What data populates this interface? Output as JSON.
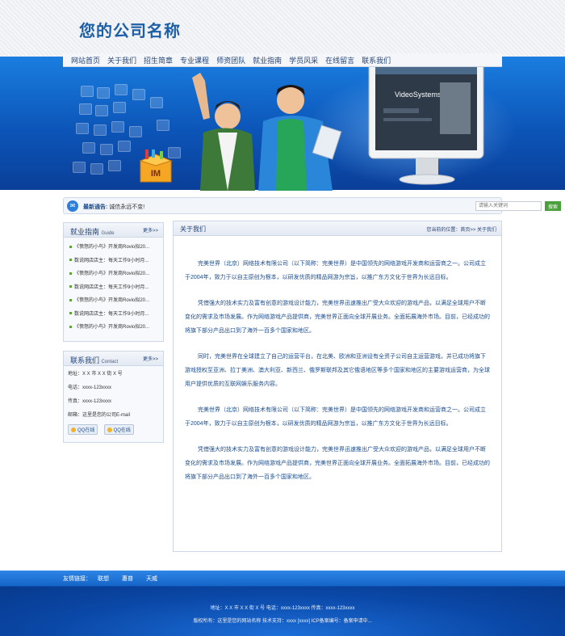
{
  "brand": {
    "name": "您的公司名称"
  },
  "nav": [
    "网站首页",
    "关于我们",
    "招生简章",
    "专业课程",
    "师资团队",
    "就业指南",
    "学员风采",
    "在线留言",
    "联系我们"
  ],
  "notice": {
    "label": "最新通告:",
    "text": "诚信永远不变!",
    "search_placeholder": "请输入关键词",
    "search_button": "搜索"
  },
  "sidebar": {
    "guide": {
      "title": "就业指南",
      "title_en": "Guide",
      "more": "更多>>",
      "items": [
        "《愤怒的小鸟》开发商Rovio拟20...",
        "数说网店店主：每天工作9小时月...",
        "《愤怒的小鸟》开发商Rovio拟20...",
        "数说网店店主：每天工作9小时月...",
        "《愤怒的小鸟》开发商Rovio拟20...",
        "数说网店店主：每天工作9小时月...",
        "《愤怒的小鸟》开发商Rovio拟20..."
      ]
    },
    "contact": {
      "title": "联系我们",
      "title_en": "Contact",
      "more": "更多>>",
      "address": "地址：X X 市 X X 街 X 号",
      "phone": "电话：xxxx-123xxxx",
      "fax": "传真：xxxx-123xxxx",
      "email": "邮箱：这里是您的公司E-mail",
      "qq1": "QQ在线",
      "qq2": "QQ在线"
    }
  },
  "main": {
    "title": "关于我们",
    "breadcrumb": "您当前的位置：首页>> 关于我们",
    "paragraphs": [
      "完美世界（北京）网络技术有限公司（以下简称：完美世界）是中国领先的网络游戏开发商和运营商之一。公司成立于2004年，致力于以自主原创为根本，以研发优质的精品网游为宗旨，以推广东方文化于世界为长远目标。",
      "凭借强大的技术实力及富有创意的游戏设计能力，完美世界迅速推出广受大众欢迎的游戏产品，以满足全球用户不断变化的需求及市场发展。作为网络游戏产品提供商，完美世界正面向全球开展业务。全面拓展海外市场。目前，已经成功的将旗下部分产品出口到了海外一百多个国家和地区。",
      "同时，完美世界在全球建立了自己的运营平台，在北美、欧洲和亚洲设有全资子公司自主运营游戏，并已成功将旗下游戏授权至亚洲、拉丁美洲、澳大利亚、新西兰、俄罗斯联邦及其它俄语地区等多个国家和地区的主要游戏运营商，为全球用户提供优质的互联网娱乐服务内容。",
      "完美世界（北京）网络技术有限公司（以下简称：完美世界）是中国领先的网络游戏开发商和运营商之一。公司成立于2004年，致力于以自主原创为根本，以研发优质的精品网游为宗旨，以推广东方文化于世界为长远目标。",
      "凭借强大的技术实力及富有创意的游戏设计能力，完美世界迅速推出广受大众欢迎的游戏产品，以满足全球用户不断变化的需求及市场发展。作为网络游戏产品提供商，完美世界正面向全球开展业务。全面拓展海外市场。目前，已经成功的将旗下部分产品出口到了海外一百多个国家和地区。"
    ]
  },
  "banner": {
    "box_label": "IM",
    "screen_text": "VideoSystems"
  },
  "links": {
    "label": "友情链接：",
    "items": [
      "联想",
      "惠普",
      "天威"
    ]
  },
  "footer": {
    "line1": "地址：X X 市 X X 街 X 号 电话：xxxx-123xxxx 传真：xxxx-123xxxx",
    "line2": "版权所有：这里是您的网站名称 技术支持：xxxx [xxxx] ICP备案编号：备案申请中..."
  },
  "colors": {
    "brand": "#1e5fa6",
    "banner": "#0c55b8",
    "link_text": "#1c4c8c",
    "accent_green": "#4aa03a"
  }
}
